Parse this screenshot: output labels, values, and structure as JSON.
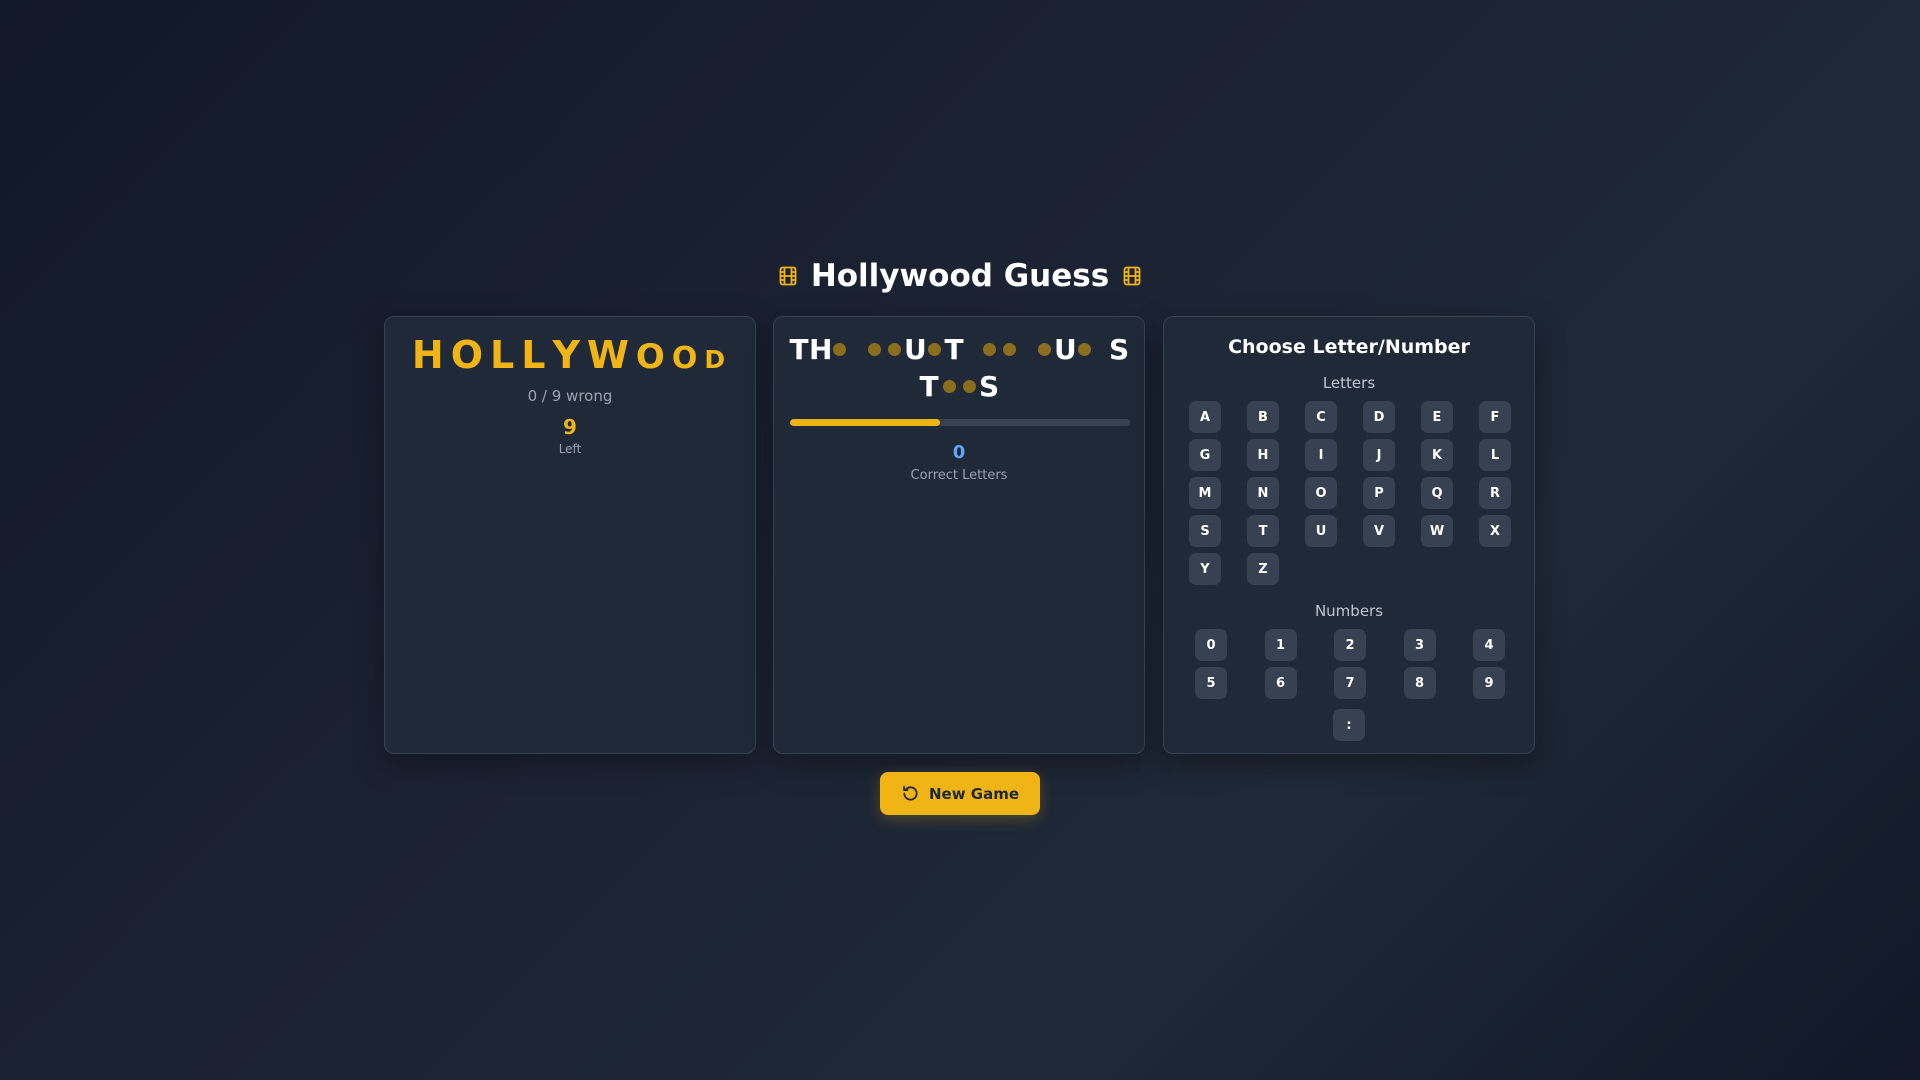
{
  "header": {
    "title": "Hollywood Guess",
    "left_icon": "film-icon",
    "right_icon": "film-icon",
    "accent_color": "#f0b414"
  },
  "hollywood_meter": {
    "letters": [
      "H",
      "O",
      "L",
      "L",
      "Y",
      "W",
      "O",
      "O",
      "D"
    ],
    "wrong_text": "0 / 9 wrong",
    "left_count": "9",
    "left_label": "Left"
  },
  "puzzle": {
    "lines": [
      [
        {
          "c": "T"
        },
        {
          "c": "H"
        },
        {
          "c": "_"
        },
        {
          "c": " "
        },
        {
          "c": "_"
        },
        {
          "c": "_"
        },
        {
          "c": "U"
        },
        {
          "c": "_"
        },
        {
          "c": "T"
        },
        {
          "c": " "
        },
        {
          "c": "_"
        },
        {
          "c": "_"
        },
        {
          "c": " "
        },
        {
          "c": "_"
        },
        {
          "c": "U"
        },
        {
          "c": "_"
        },
        {
          "c": " "
        },
        {
          "c": "S"
        }
      ],
      [
        {
          "c": "T"
        },
        {
          "c": "_"
        },
        {
          "c": "_"
        },
        {
          "c": "S"
        }
      ]
    ],
    "progress_fraction": 0.44,
    "progress_color": "#f0b414",
    "correct_count": "0",
    "correct_label": "Correct Letters"
  },
  "keyboard": {
    "title": "Choose Letter/Number",
    "letters_label": "Letters",
    "numbers_label": "Numbers",
    "letters": [
      "A",
      "B",
      "C",
      "D",
      "E",
      "F",
      "G",
      "H",
      "I",
      "J",
      "K",
      "L",
      "M",
      "N",
      "O",
      "P",
      "Q",
      "R",
      "S",
      "T",
      "U",
      "V",
      "W",
      "X",
      "Y",
      "Z"
    ],
    "numbers": [
      "0",
      "1",
      "2",
      "3",
      "4",
      "5",
      "6",
      "7",
      "8",
      "9"
    ],
    "extra": ":"
  },
  "actions": {
    "new_game_label": "New Game",
    "new_game_icon": "restart-icon"
  }
}
